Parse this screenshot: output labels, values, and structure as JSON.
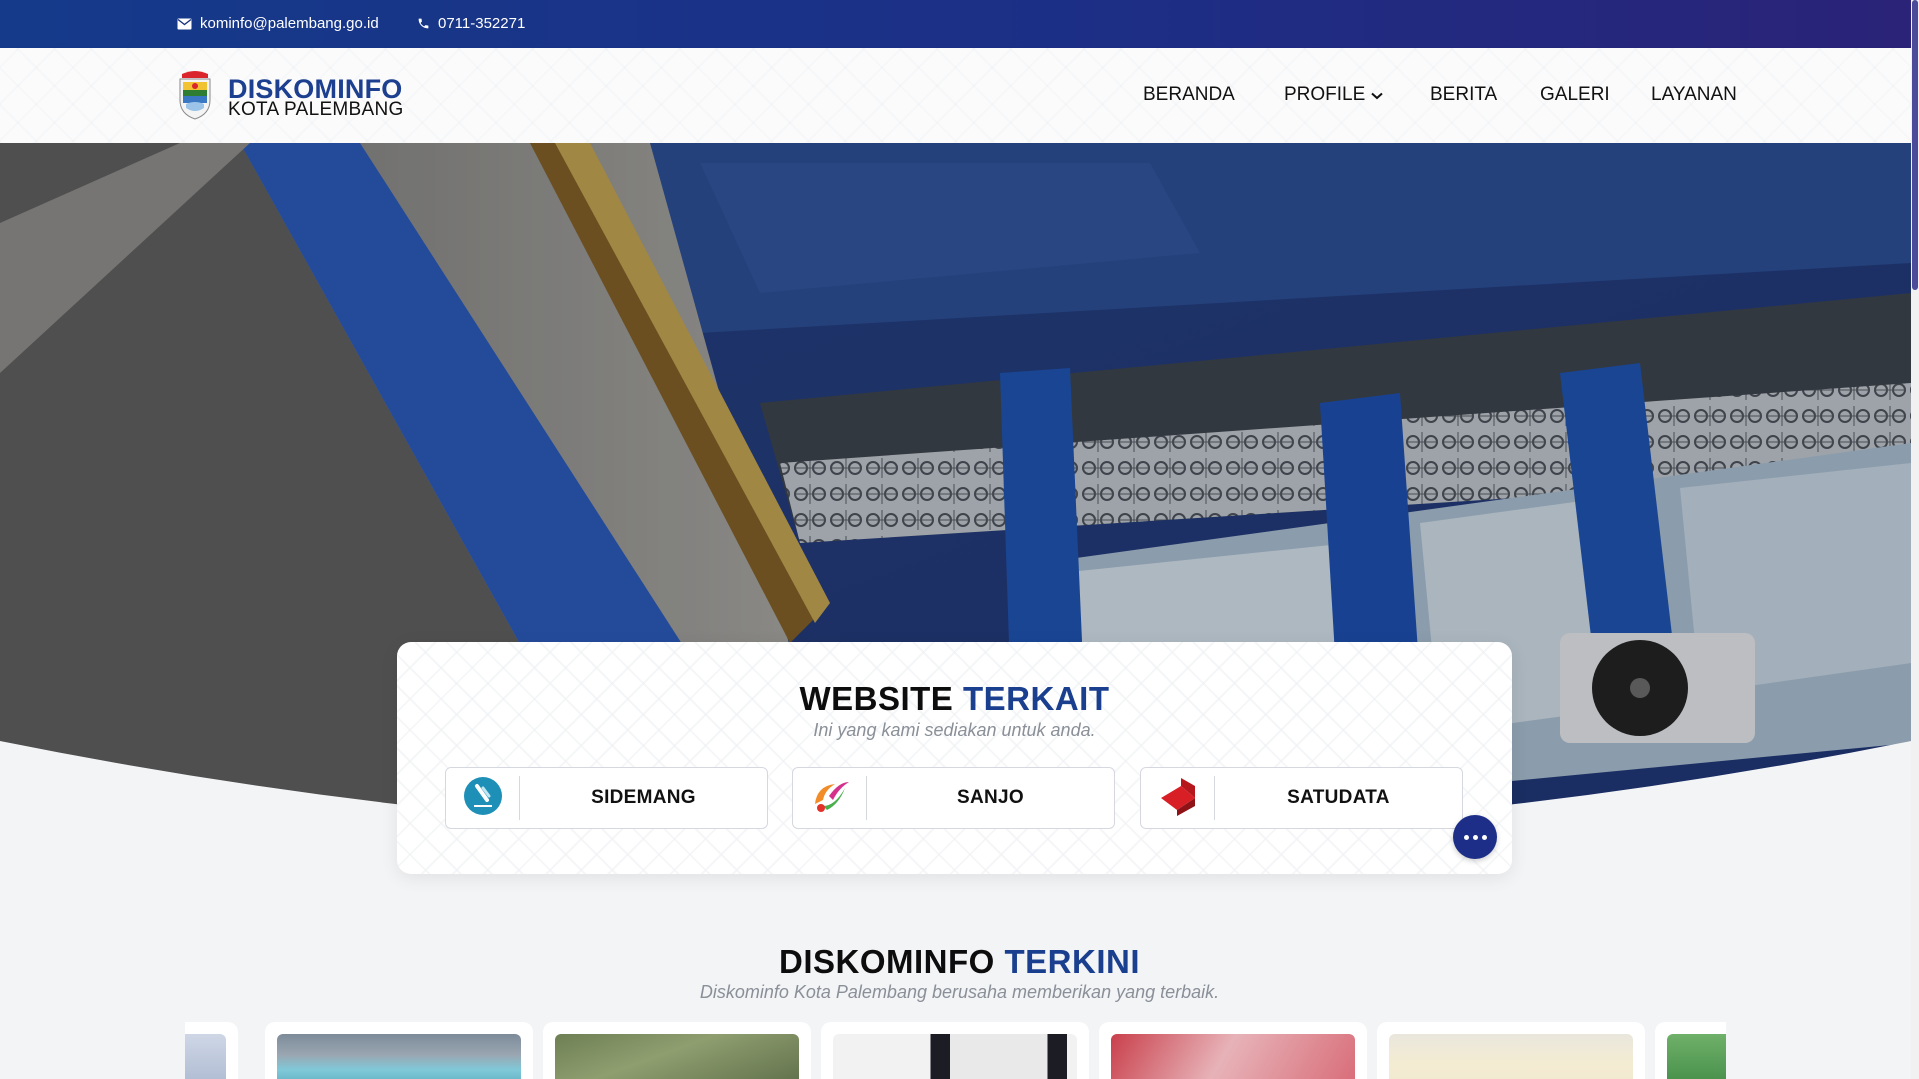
{
  "topbar": {
    "email": "kominfo@palembang.go.id",
    "email_icon": "envelope-icon",
    "phone": "0711-352271",
    "phone_icon": "phone-icon"
  },
  "header": {
    "logo_title": "DISKOMINFO",
    "logo_subtitle": "KOTA PALEMBANG",
    "logo_icon": "palembang-city-emblem",
    "nav": [
      {
        "label": "BERANDA"
      },
      {
        "label": "PROFILE",
        "icon": "chevron-down-icon"
      },
      {
        "label": "BERITA"
      },
      {
        "label": "GALERI"
      },
      {
        "label": "LAYANAN"
      }
    ]
  },
  "related": {
    "title_a": "WEBSITE",
    "title_b": "TERKAIT",
    "subtitle": "Ini yang kami sediakan untuk anda.",
    "sites": [
      {
        "label": "SIDEMANG",
        "icon": "sidemang-logo-icon"
      },
      {
        "label": "SANJO",
        "icon": "sanjo-logo-icon"
      },
      {
        "label": "SATUDATA",
        "icon": "satudata-logo-icon"
      }
    ],
    "more_icon": "more-dots-icon"
  },
  "news": {
    "title_a": "DISKOMINFO",
    "title_b": "TERKINI",
    "subtitle": "Diskominfo Kota Palembang berusaha memberikan yang terbaik."
  },
  "colors": {
    "brand_blue": "#1b3f8f",
    "topbar_start": "#153a8a",
    "topbar_end": "#2a2378",
    "more_button": "#1c2e88"
  }
}
